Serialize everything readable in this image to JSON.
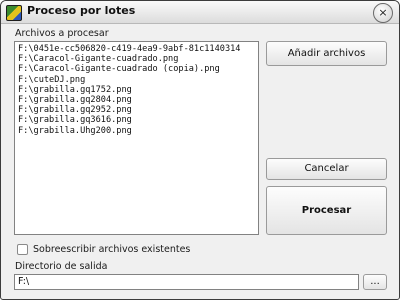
{
  "window": {
    "title": "Proceso por lotes",
    "close_glyph": "×"
  },
  "files_label": "Archivos a procesar",
  "files": [
    "F:\\0451e-cc506820-c419-4ea9-9abf-81c1140314",
    "F:\\Caracol-Gigante-cuadrado.png",
    "F:\\Caracol-Gigante-cuadrado (copia).png",
    "F:\\cuteDJ.png",
    "F:\\grabilla.gq1752.png",
    "F:\\grabilla.gq2804.png",
    "F:\\grabilla.gq2952.png",
    "F:\\grabilla.gq3616.png",
    "F:\\grabilla.Uhg200.png"
  ],
  "buttons": {
    "add_files": "Añadir archivos",
    "cancel": "Cancelar",
    "process": "Procesar",
    "browse": "..."
  },
  "overwrite": {
    "label": "Sobreescribir archivos existentes",
    "checked": false
  },
  "output": {
    "label": "Directorio de salida",
    "value": "F:\\"
  },
  "icons": {
    "app": "app-icon",
    "close": "close-icon"
  }
}
